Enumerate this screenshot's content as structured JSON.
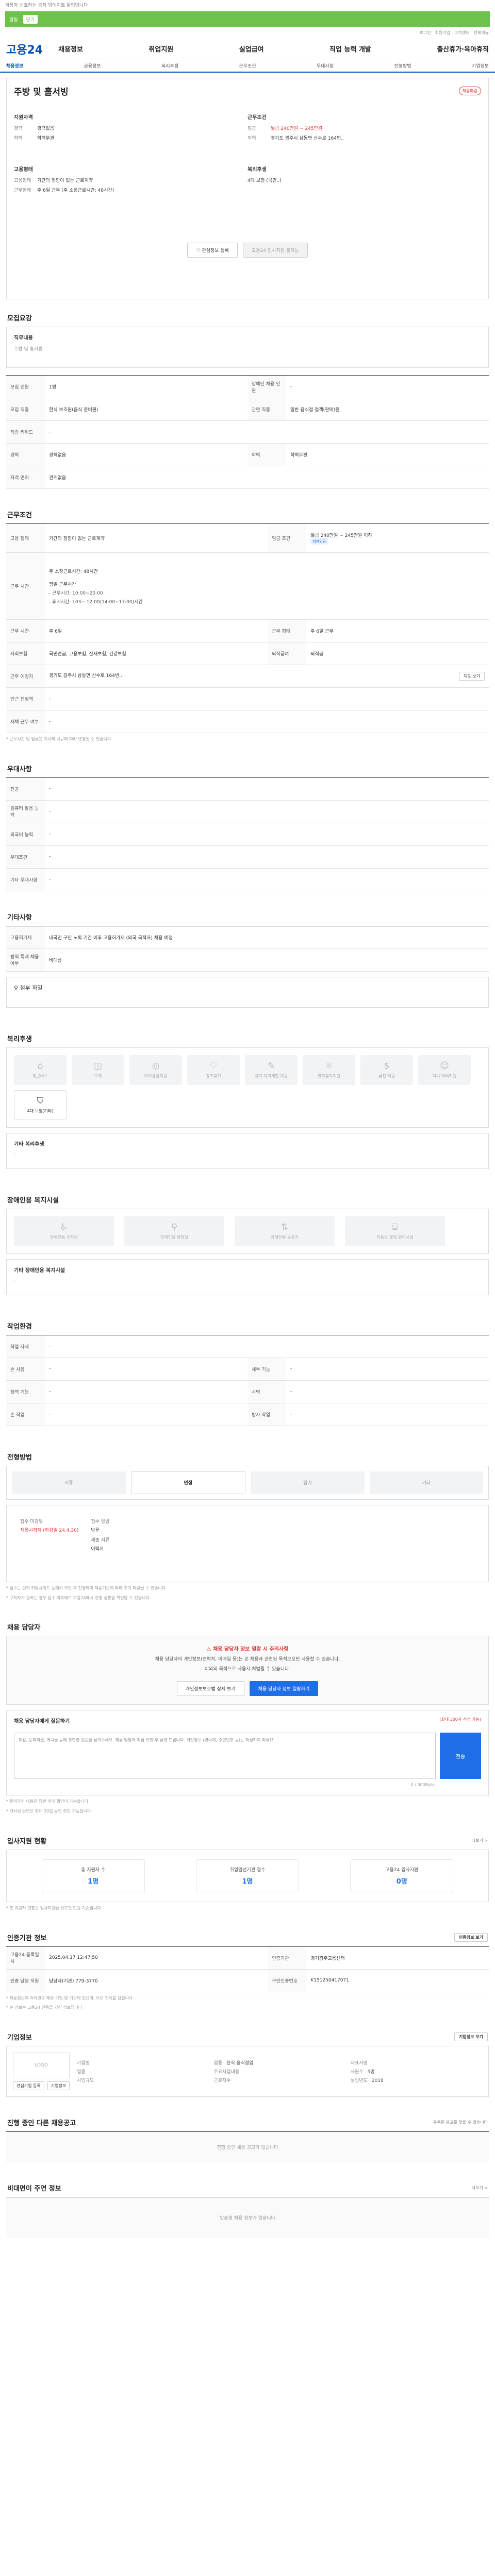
{
  "top_notice": "이용자 선호하는 공지 업데이트 알림입니다",
  "banner": {
    "label": "알림",
    "btn": "닫기"
  },
  "util": [
    "로그인",
    "회원가입",
    "고객센터",
    "전체메뉴"
  ],
  "logo": "고용24",
  "gnb": [
    "채용정보",
    "취업지원",
    "실업급여",
    "직업 능력 개발",
    "출산휴가·육아휴직"
  ],
  "subnav": [
    "채용정보",
    "금융정보",
    "복리후생",
    "근무조건",
    "우대사항",
    "전형방법",
    "기업정보"
  ],
  "job": {
    "title": "주방 및 홀서빙",
    "tag": "채용마감",
    "left_label": "지원자격",
    "right_label": "근무조건",
    "left": [
      {
        "k": "경력",
        "v": "경력없음"
      },
      {
        "k": "학력",
        "v": "학력무관"
      }
    ],
    "right": [
      {
        "k": "임금",
        "v": "월급 240만원 ~ 245만원",
        "red": true
      },
      {
        "k": "지역",
        "v": "경기도 광주시 삼동면 산수로 164번..",
        "red": false
      }
    ],
    "left2_label": "고용형태",
    "left2": [
      {
        "k": "고용형태",
        "v": "기간의 정함이 없는 근로계약"
      },
      {
        "k": "근무형태",
        "v": "주 6일 근무 (주 소정근로시간: 48시간)"
      }
    ],
    "right2_label": "복리후생",
    "right2": [
      {
        "k": "",
        "v": "4대 보험 (국민..)"
      }
    ],
    "buttons": [
      "관심정보 등록",
      "고용24 입사지원 불가능"
    ]
  },
  "recruit": {
    "title": "모집요강",
    "task_label": "직무내용",
    "task": "주방 및 홀서빙",
    "rows": [
      {
        "a": "모집 인원",
        "b": "1명",
        "c": "장애인 채용 인원",
        "d": "-"
      },
      {
        "a": "모집 직종",
        "b": "한식 보조원(음식 준비원)",
        "c": "관련 직종",
        "d": "일반 음식점 접객(판매)원"
      },
      {
        "a": "직종 키워드",
        "b": "-",
        "c": "",
        "d": ""
      },
      {
        "a": "경력",
        "b": "경력없음",
        "c": "학력",
        "d": "학력무관"
      },
      {
        "a": "자격 면허",
        "b": "관계없음",
        "c": "",
        "d": ""
      }
    ]
  },
  "conditions": {
    "title": "근무조건",
    "employ_type": "기간의 정함이 없는 근로계약",
    "wage_label": "임금 조건",
    "wage": "월급 240만원 ~ 245만원 이하",
    "wage_pill": "최저임금",
    "hours": "주 소정근로시간: 48시간",
    "shift_title": "평일 근무시간",
    "shift": [
      "- 근무시간: 10:00~20:00",
      "- 휴게시간: 103~ 12:00(14:00~17:00)시간"
    ],
    "rows": [
      {
        "a": "근무 시간",
        "b": "주 6일",
        "c": "근무 형태",
        "d": "주 6일 근무"
      },
      {
        "a": "사회보험",
        "b": "국민연금, 고용보험, 산재보험, 건강보험",
        "c": "퇴직급여",
        "d": "퇴직금"
      },
      {
        "a": "근무 예정지",
        "b": "경기도 광주시 삼동면 산수로 164번..",
        "c": "",
        "d": ""
      },
      {
        "a": "인근 전철역",
        "b": "-",
        "c": "",
        "d": ""
      },
      {
        "a": "재택 근무 여부",
        "b": "-",
        "c": "",
        "d": ""
      }
    ],
    "map_btn": "지도 보기",
    "note": "* 근무시간 및 임금은 회사의 내규에 따라 변경될 수 있습니다"
  },
  "prefer": {
    "title": "우대사항",
    "rows": [
      {
        "a": "전공",
        "b": "-"
      },
      {
        "a": "컴퓨터 활용 능력",
        "b": "-"
      },
      {
        "a": "외국어 능력",
        "b": "-"
      },
      {
        "a": "우대조건",
        "b": "-"
      },
      {
        "a": "기타 우대사항",
        "b": "-"
      }
    ]
  },
  "etc": {
    "title": "기타사항",
    "rows": [
      {
        "a": "고용허가제",
        "b": "내국인 구인 노력 기간 이후 고용허가제 (외국 국적자) 채용 예정"
      },
      {
        "a": "병역 특례 채용 여부",
        "b": "비대상"
      }
    ],
    "attach_label": "첨부 파일"
  },
  "welfare": {
    "title": "복리후생",
    "items": [
      {
        "icon": "housing-icon",
        "glyph": "⌂",
        "label": "통근버스",
        "on": false
      },
      {
        "icon": "meal-icon",
        "glyph": "◫",
        "label": "주택",
        "on": false
      },
      {
        "icon": "sports-icon",
        "glyph": "◎",
        "label": "여가생활지원",
        "on": false
      },
      {
        "icon": "health-icon",
        "glyph": "♡",
        "label": "경조휴가",
        "on": false
      },
      {
        "icon": "edu-icon",
        "glyph": "✎",
        "label": "자기 자기개발 지원",
        "on": false
      },
      {
        "icon": "vacation-icon",
        "glyph": "☼",
        "label": "연차휴가지원",
        "on": false
      },
      {
        "icon": "money-icon",
        "glyph": "$",
        "label": "금전 지원",
        "on": false
      },
      {
        "icon": "child-icon",
        "glyph": "☺",
        "label": "자녀 학비지원",
        "on": false
      },
      {
        "icon": "insurance-icon",
        "glyph": "⛉",
        "label": "4대 보험(기타)",
        "on": true
      }
    ],
    "etc_label": "기타 복리후생",
    "etc_value": "-"
  },
  "disabled": {
    "title": "장애인용 복지시설",
    "items": [
      {
        "icon": "ramp-icon",
        "glyph": "♿",
        "label": "장애인용 주차장"
      },
      {
        "icon": "toilet-icon",
        "glyph": "⚲",
        "label": "장애인용 화장실"
      },
      {
        "icon": "elevator-icon",
        "glyph": "⇅",
        "label": "장애인용 승강기"
      },
      {
        "icon": "door-icon",
        "glyph": "⌸",
        "label": "자동문 출입 편의시설"
      }
    ],
    "etc_label": "기타 장애인용 복지시설",
    "etc_value": "-"
  },
  "env": {
    "title": "작업환경",
    "rows": [
      {
        "a": "작업 자세",
        "b": "-",
        "c": "",
        "d": ""
      },
      {
        "a": "손 사용",
        "b": "-",
        "c": "세부 기능",
        "d": "-"
      },
      {
        "a": "청력 기능",
        "b": "-",
        "c": "시력",
        "d": "-"
      },
      {
        "a": "손 작업",
        "b": "-",
        "c": "방사 작업",
        "d": "-"
      }
    ]
  },
  "process": {
    "title": "전형방법",
    "steps": [
      {
        "label": "서류",
        "on": false
      },
      {
        "label": "면접",
        "on": true
      },
      {
        "label": "필기",
        "on": false
      },
      {
        "label": "기타",
        "on": false
      }
    ],
    "summary": [
      {
        "k": "접수 마감일",
        "v": "채용시까지 (마감일 24.4.30)",
        "red": true
      },
      {
        "k": "접수 방법",
        "v": "방문"
      },
      {
        "k": "제출 서류",
        "v": "이력서"
      }
    ],
    "notes": [
      "* 접수는 먼저 취업사이트 등에서 확인 후 진행하며 채용기준에 따라 조기 마감될 수 있습니다",
      "* 구직자가 원하는 경우 접수 이후에도 고용24에서 진행 상황을 확인할 수 있습니다"
    ]
  },
  "manager": {
    "title": "채용 담당자",
    "warn": "채용 담당자 정보 열람 시 주의사항",
    "desc1": "채용 담당자의 개인정보(연락처, 이메일 등)는 본 채용과 관련된 목적으로만 사용할 수 있습니다.",
    "desc2": "이외의 목적으로 사용시 처벌될 수 있습니다.",
    "btn1": "개인정보보호법 상세 보기",
    "btn2": "채용 담당자 정보 열람하기",
    "q_label": "채용 담당자에게 질문하기",
    "q_hint": "(최대 300자 작성 가능)",
    "q_placeholder": "채용, 문제해결, 게시물 등에 관련한 질문을 남겨주세요. 채용 담당자 직접 확인 후 답변 드립니다. 개인정보 (연락처, 주민번호 등)는 작성하지 마세요.",
    "q_count": "0 / 300Byte",
    "q_btn": "전송",
    "notes": [
      "* 문의하신 내용은 답변 후에 확인이 가능합니다",
      "* 게시된 답변은 최대 30일 동안 확인 가능합니다"
    ]
  },
  "apply_stats": {
    "title": "입사지원 현황",
    "more": "더보기 >",
    "items": [
      {
        "label": "총 지원자 수",
        "value": "1명"
      },
      {
        "label": "취업알선기관 접수",
        "value": "1명"
      },
      {
        "label": "고용24 입사지원",
        "value": "0명"
      }
    ],
    "note": "* 본 지원자 현황은 입사지원을 완료한 인원 기준입니다"
  },
  "info": {
    "title": "인증기관 정보",
    "btn": "인증정보 보기",
    "rows": [
      {
        "a": "고용24 등록일시",
        "b": "2025.04.17 12:47:50",
        "c": "인증기관",
        "d": "경기광주고용센터"
      },
      {
        "a": "인증 담당 직원",
        "b": "담당자(기관) 779-3770",
        "c": "구인인증번호",
        "d": "K151250417071"
      }
    ],
    "notes": [
      "* 채용정보의 저작권은 해당 기업 및 기관에 있으며, 무단 전재를 금합니다",
      "* 본 정보는 고용24 인증을 거친 정보입니다"
    ]
  },
  "company": {
    "title": "기업정보",
    "btn": "기업정보 보기",
    "logo": "LOGO",
    "fields": [
      "기업명",
      "업종",
      "대표자명",
      "업종",
      "주요사업내용",
      "사원수",
      "사업규모",
      "근로자수",
      "설립년도"
    ],
    "values": [
      "",
      "한식 음식점업",
      "",
      "",
      "",
      "5명",
      "",
      "",
      "2018"
    ],
    "links": [
      "관심기업 등록",
      "기업정보"
    ]
  },
  "other_jobs": {
    "title": "진행 중인 다른 채용공고",
    "hint": "등록된 공고를 찾을 수 없습니다",
    "empty": "진행 중인 채용 공고가 없습니다"
  },
  "recommend": {
    "title": "비대면이 주연 정보",
    "more": "더보기 >",
    "empty": "맞춤형 채용 정보가 없습니다"
  }
}
